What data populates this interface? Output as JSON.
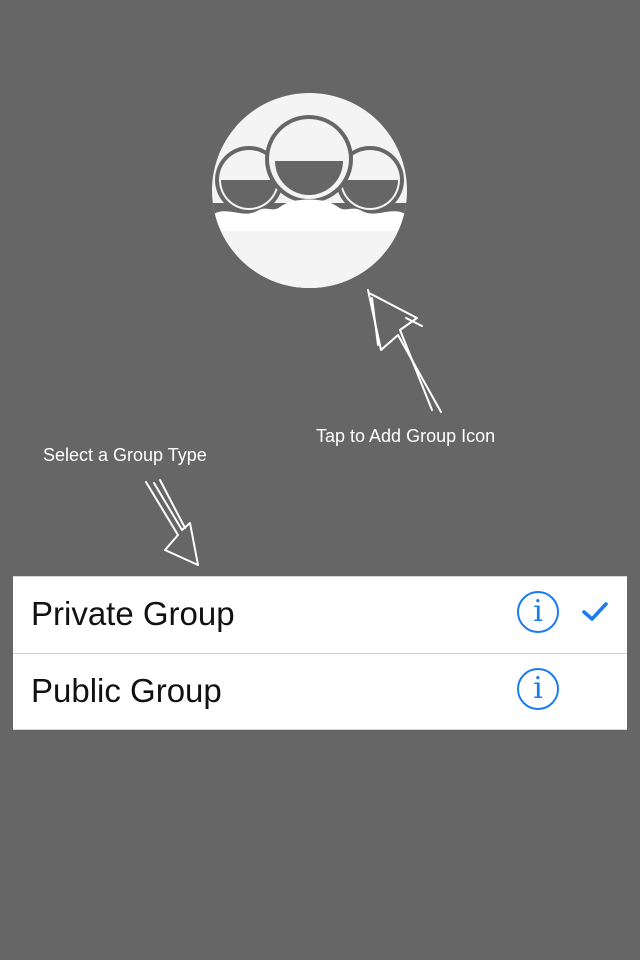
{
  "group_icon": {
    "icon": "people-icon"
  },
  "hints": {
    "add_icon": "Tap to Add Group Icon",
    "select_type": "Select a Group Type"
  },
  "group_types": [
    {
      "label": "Private Group",
      "selected": true,
      "info_icon": "info-icon"
    },
    {
      "label": "Public Group",
      "selected": false,
      "info_icon": "info-icon"
    }
  ],
  "colors": {
    "background": "#666666",
    "accent": "#1a7cf1",
    "row_background": "#ffffff",
    "icon_fill": "#f4f4f4"
  }
}
